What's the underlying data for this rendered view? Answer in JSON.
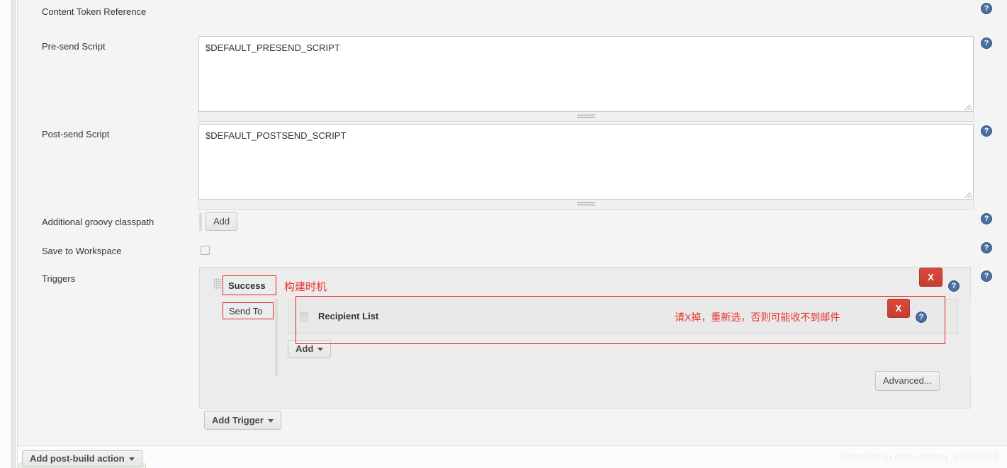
{
  "page": {
    "watermark": "https://blog.csdn.net/qq_33553515",
    "accent_red": "#e8342b",
    "help_blue": "#4a6fa5",
    "x_button_red": "#c73e31"
  },
  "rows": [
    {
      "label": "Content Token Reference"
    },
    {
      "label": "Pre-send Script"
    },
    {
      "label": "Post-send Script"
    },
    {
      "label": "Additional groovy classpath"
    },
    {
      "label": "Save to Workspace"
    },
    {
      "label": "Triggers"
    }
  ],
  "fields": {
    "presend_script": {
      "value": "$DEFAULT_PRESEND_SCRIPT",
      "placeholder": ""
    },
    "postsend_script": {
      "value": "$DEFAULT_POSTSEND_SCRIPT",
      "placeholder": ""
    },
    "groovy_classpath_add": "Add",
    "save_to_workspace_checked": false
  },
  "triggers": {
    "trigger_name": "Success",
    "send_to_label": "Send To",
    "recipient_list_label": "Recipient List",
    "add_button": "Add",
    "advanced_button": "Advanced...",
    "add_trigger_button": "Add Trigger",
    "remove_trigger_button": "X",
    "remove_recipient_button": "X"
  },
  "annotations": [
    {
      "id": "build-timing",
      "text": "构建时机"
    },
    {
      "id": "reselect-warning",
      "text": "请X掉，重新选，否则可能收不到邮件"
    }
  ],
  "footer": {
    "add_post_build_action": "Add post-build action"
  },
  "icons": {
    "help": "?",
    "caret_down": "▼"
  }
}
